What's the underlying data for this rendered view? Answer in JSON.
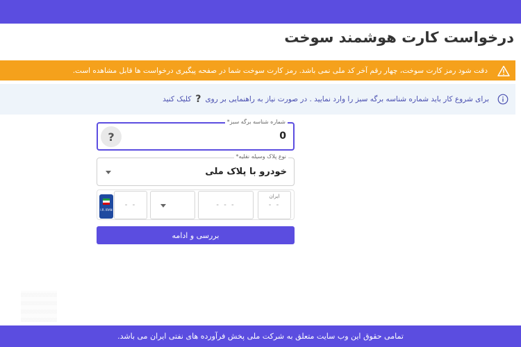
{
  "page": {
    "title": "درخواست کارت هوشمند سوخت"
  },
  "alerts": {
    "warning": "دقت شود رمز کارت سوخت، چهار رقم آخر کد ملی نمی باشد. رمز کارت سوخت شما در صفحه پیگیری درخواست ها قابل مشاهده است.",
    "info_before": "برای شروع کار باید شماره شناسه برگه سبز را وارد نمایید . در صورت نیاز به راهنمایی بر روی",
    "info_icon": "?",
    "info_link": "کلیک کنید"
  },
  "form": {
    "sticker_label": "شماره شناسه برگه سبز*",
    "sticker_value": "0",
    "help_button": "?",
    "plate_type_label": "نوع پلاک وسیله نقلیه*",
    "plate_type_value": "خودرو با پلاک ملی",
    "plate": {
      "iran_label": "ایران",
      "part_iran_placeholder": "- -",
      "part_three_placeholder": "- - -",
      "part_two_placeholder": "- -",
      "flag_text": "I.R. IRAN"
    },
    "submit_label": "بررسی و ادامه"
  },
  "footer": {
    "text": "تمامی حقوق این وب سایت متعلق به شرکت ملی پخش فرآورده های نفتی ایران می باشد."
  },
  "colors": {
    "primary": "#5b4de0",
    "warning": "#f5a11c",
    "info_bg": "#eef4fa"
  }
}
